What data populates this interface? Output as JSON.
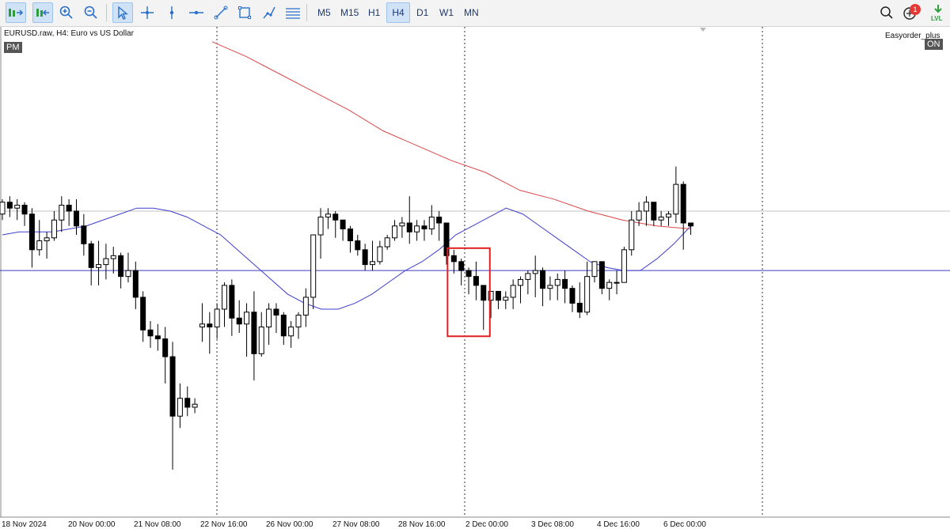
{
  "toolbar": {
    "tools": [
      "autoscroll-icon",
      "chart-shift-icon",
      "zoom-in-icon",
      "zoom-out-icon",
      "cursor-icon",
      "crosshair-icon",
      "vertical-line-icon",
      "horizontal-line-icon",
      "trendline-icon",
      "rectangle-icon",
      "brush-icon",
      "fibo-icon"
    ],
    "timeframes": [
      "M5",
      "M15",
      "H1",
      "H4",
      "D1",
      "W1",
      "MN"
    ],
    "active_timeframe": "H4",
    "notification_count": "1",
    "lvl_label": "LVL"
  },
  "chart": {
    "symbol_title": "EURUSD.raw, H4:  Euro vs US Dollar",
    "pm_label": "PM",
    "easyorder_label": "Easyorder_plus",
    "on_label": "ON",
    "x_labels": [
      "18 Nov 2024",
      "20 Nov 00:00",
      "21 Nov 08:00",
      "22 Nov 16:00",
      "26 Nov 00:00",
      "27 Nov 08:00",
      "28 Nov 16:00",
      "2 Dec 00:00",
      "3 Dec 08:00",
      "4 Dec 16:00",
      "6 Dec 00:00"
    ]
  },
  "chart_data": {
    "type": "candlestick",
    "symbol": "EURUSD.raw",
    "timeframe": "H4",
    "x_labels": [
      "18 Nov 2024",
      "20 Nov 00:00",
      "21 Nov 08:00",
      "22 Nov 16:00",
      "26 Nov 00:00",
      "27 Nov 08:00",
      "28 Nov 16:00",
      "2 Dec 00:00",
      "3 Dec 08:00",
      "4 Dec 16:00",
      "6 Dec 00:00"
    ],
    "candles": [
      [
        0.62,
        0.66,
        0.6,
        0.67
      ],
      [
        0.66,
        0.64,
        0.61,
        0.68
      ],
      [
        0.64,
        0.65,
        0.6,
        0.67
      ],
      [
        0.65,
        0.62,
        0.58,
        0.66
      ],
      [
        0.62,
        0.5,
        0.44,
        0.64
      ],
      [
        0.5,
        0.53,
        0.48,
        0.6
      ],
      [
        0.53,
        0.54,
        0.47,
        0.56
      ],
      [
        0.54,
        0.6,
        0.53,
        0.63
      ],
      [
        0.6,
        0.65,
        0.56,
        0.68
      ],
      [
        0.65,
        0.63,
        0.58,
        0.67
      ],
      [
        0.63,
        0.58,
        0.55,
        0.67
      ],
      [
        0.58,
        0.52,
        0.48,
        0.62
      ],
      [
        0.52,
        0.44,
        0.38,
        0.53
      ],
      [
        0.44,
        0.45,
        0.38,
        0.53
      ],
      [
        0.45,
        0.47,
        0.4,
        0.52
      ],
      [
        0.47,
        0.48,
        0.42,
        0.51
      ],
      [
        0.48,
        0.41,
        0.37,
        0.49
      ],
      [
        0.41,
        0.43,
        0.39,
        0.49
      ],
      [
        0.43,
        0.34,
        0.3,
        0.46
      ],
      [
        0.34,
        0.23,
        0.19,
        0.36
      ],
      [
        0.23,
        0.21,
        0.17,
        0.26
      ],
      [
        0.21,
        0.2,
        0.16,
        0.25
      ],
      [
        0.2,
        0.14,
        0.05,
        0.24
      ],
      [
        0.14,
        -0.06,
        -0.24,
        0.19
      ],
      [
        -0.06,
        0.0,
        -0.1,
        0.05
      ],
      [
        0.0,
        -0.03,
        -0.06,
        0.04
      ],
      [
        -0.03,
        -0.02,
        -0.05,
        0.0
      ],
      [
        0.24,
        0.25,
        0.19,
        0.32
      ],
      [
        0.25,
        0.24,
        0.15,
        0.29
      ],
      [
        0.24,
        0.3,
        0.2,
        0.32
      ],
      [
        0.3,
        0.38,
        0.24,
        0.39
      ],
      [
        0.38,
        0.27,
        0.21,
        0.4
      ],
      [
        0.27,
        0.25,
        0.22,
        0.33
      ],
      [
        0.25,
        0.29,
        0.14,
        0.32
      ],
      [
        0.29,
        0.15,
        0.06,
        0.36
      ],
      [
        0.15,
        0.24,
        0.14,
        0.29
      ],
      [
        0.24,
        0.3,
        0.18,
        0.32
      ],
      [
        0.3,
        0.28,
        0.22,
        0.32
      ],
      [
        0.28,
        0.21,
        0.18,
        0.29
      ],
      [
        0.21,
        0.24,
        0.17,
        0.26
      ],
      [
        0.24,
        0.28,
        0.2,
        0.29
      ],
      [
        0.28,
        0.34,
        0.24,
        0.37
      ],
      [
        0.34,
        0.55,
        0.3,
        0.55
      ],
      [
        0.55,
        0.61,
        0.47,
        0.64
      ],
      [
        0.61,
        0.62,
        0.57,
        0.64
      ],
      [
        0.62,
        0.6,
        0.54,
        0.63
      ],
      [
        0.6,
        0.57,
        0.53,
        0.6
      ],
      [
        0.57,
        0.53,
        0.49,
        0.58
      ],
      [
        0.53,
        0.5,
        0.48,
        0.55
      ],
      [
        0.5,
        0.45,
        0.43,
        0.52
      ],
      [
        0.45,
        0.46,
        0.43,
        0.53
      ],
      [
        0.46,
        0.51,
        0.45,
        0.53
      ],
      [
        0.51,
        0.54,
        0.5,
        0.55
      ],
      [
        0.54,
        0.58,
        0.53,
        0.6
      ],
      [
        0.58,
        0.59,
        0.54,
        0.61
      ],
      [
        0.59,
        0.56,
        0.52,
        0.68
      ],
      [
        0.56,
        0.58,
        0.53,
        0.6
      ],
      [
        0.58,
        0.57,
        0.53,
        0.6
      ],
      [
        0.57,
        0.61,
        0.55,
        0.65
      ],
      [
        0.61,
        0.59,
        0.53,
        0.63
      ],
      [
        0.59,
        0.48,
        0.45,
        0.59
      ],
      [
        0.48,
        0.46,
        0.42,
        0.5
      ],
      [
        0.46,
        0.43,
        0.38,
        0.47
      ],
      [
        0.43,
        0.41,
        0.35,
        0.44
      ],
      [
        0.41,
        0.38,
        0.33,
        0.46
      ],
      [
        0.38,
        0.33,
        0.23,
        0.38
      ],
      [
        0.33,
        0.36,
        0.27,
        0.36
      ],
      [
        0.36,
        0.33,
        0.3,
        0.36
      ],
      [
        0.33,
        0.34,
        0.3,
        0.36
      ],
      [
        0.34,
        0.38,
        0.3,
        0.4
      ],
      [
        0.38,
        0.4,
        0.32,
        0.41
      ],
      [
        0.4,
        0.42,
        0.35,
        0.43
      ],
      [
        0.42,
        0.43,
        0.34,
        0.48
      ],
      [
        0.43,
        0.37,
        0.31,
        0.44
      ],
      [
        0.37,
        0.38,
        0.33,
        0.41
      ],
      [
        0.38,
        0.4,
        0.33,
        0.42
      ],
      [
        0.4,
        0.37,
        0.32,
        0.43
      ],
      [
        0.37,
        0.32,
        0.29,
        0.38
      ],
      [
        0.32,
        0.29,
        0.27,
        0.39
      ],
      [
        0.29,
        0.41,
        0.28,
        0.46
      ],
      [
        0.41,
        0.46,
        0.39,
        0.46
      ],
      [
        0.46,
        0.37,
        0.35,
        0.46
      ],
      [
        0.37,
        0.39,
        0.33,
        0.4
      ],
      [
        0.39,
        0.39,
        0.35,
        0.43
      ],
      [
        0.39,
        0.5,
        0.4,
        0.51
      ],
      [
        0.5,
        0.6,
        0.48,
        0.63
      ],
      [
        0.6,
        0.63,
        0.58,
        0.66
      ],
      [
        0.63,
        0.66,
        0.58,
        0.68
      ],
      [
        0.66,
        0.6,
        0.58,
        0.66
      ],
      [
        0.6,
        0.61,
        0.58,
        0.63
      ],
      [
        0.61,
        0.62,
        0.58,
        0.63
      ],
      [
        0.62,
        0.72,
        0.59,
        0.78
      ],
      [
        0.72,
        0.59,
        0.5,
        0.73
      ],
      [
        0.59,
        0.58,
        0.55,
        0.59
      ]
    ],
    "moving_averages": [
      {
        "color": "#3e3ecc",
        "values": [
          0.55,
          0.56,
          0.56,
          0.56,
          0.57,
          0.58,
          0.6,
          0.62,
          0.64,
          0.64,
          0.63,
          0.61,
          0.58,
          0.55,
          0.5,
          0.45,
          0.4,
          0.35,
          0.32,
          0.3,
          0.3,
          0.32,
          0.35,
          0.39,
          0.43,
          0.46,
          0.5,
          0.55,
          0.58,
          0.61,
          0.64,
          0.62,
          0.58,
          0.54,
          0.5,
          0.46,
          0.44,
          0.43,
          0.43,
          0.47,
          0.52,
          0.58
        ]
      },
      {
        "color": "#d94848",
        "values": [
          1.2,
          1.15,
          1.09,
          1.03,
          0.97,
          0.9,
          0.85,
          0.8,
          0.76,
          0.7,
          0.67,
          0.63,
          0.6,
          0.58,
          0.57
        ]
      }
    ],
    "horizontal_lines": [
      {
        "price": 0.63,
        "color": "#c0c0c0"
      },
      {
        "price": 0.43,
        "color": "#3f3fbf"
      }
    ],
    "highlight_box": {
      "first_candle": 61,
      "last_candle": 65,
      "color": "#e02020"
    }
  }
}
